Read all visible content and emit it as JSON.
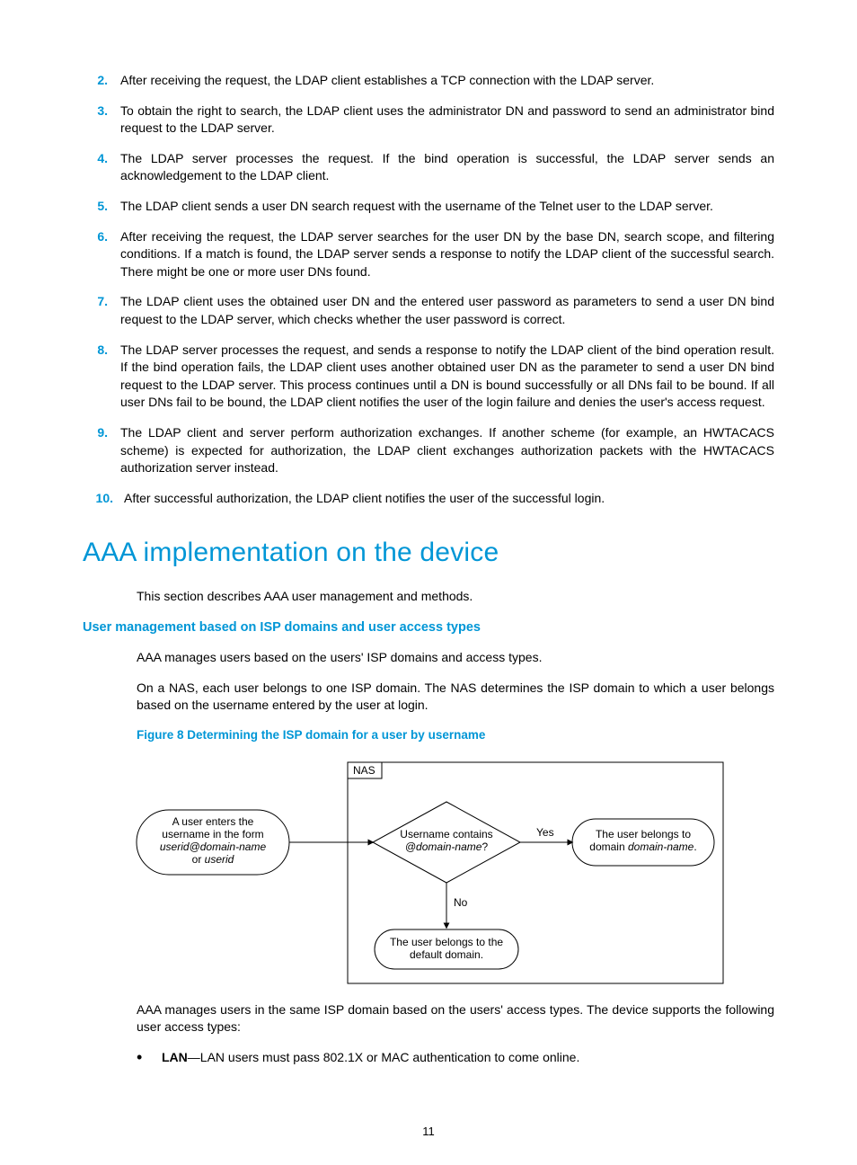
{
  "list": {
    "items": [
      {
        "num": "2.",
        "text": "After receiving the request, the LDAP client establishes a TCP connection with the LDAP server."
      },
      {
        "num": "3.",
        "text": "To obtain the right to search, the LDAP client uses the administrator DN and password to send an administrator bind request to the LDAP server."
      },
      {
        "num": "4.",
        "text": "The LDAP server processes the request. If the bind operation is successful, the LDAP server sends an acknowledgement to the LDAP client."
      },
      {
        "num": "5.",
        "text": "The LDAP client sends a user DN search request with the username of the Telnet user to the LDAP server."
      },
      {
        "num": "6.",
        "text": "After receiving the request, the LDAP server searches for the user DN by the base DN, search scope, and filtering conditions. If a match is found, the LDAP server sends a response to notify the LDAP client of the successful search. There might be one or more user DNs found."
      },
      {
        "num": "7.",
        "text": "The LDAP client uses the obtained user DN and the entered user password as parameters to send a user DN bind request to the LDAP server, which checks whether the user password is correct."
      },
      {
        "num": "8.",
        "text": "The LDAP server processes the request, and sends a response to notify the LDAP client of the bind operation result. If the bind operation fails, the LDAP client uses another obtained user DN as the parameter to send a user DN bind request to the LDAP server. This process continues until a DN is bound successfully or all DNs fail to be bound. If all user DNs fail to be bound, the LDAP client notifies the user of the login failure and denies the user's access request."
      },
      {
        "num": "9.",
        "text": "The LDAP client and server perform authorization exchanges. If another scheme (for example, an HWTACACS scheme) is expected for authorization, the LDAP client exchanges authorization packets with the HWTACACS authorization server instead."
      },
      {
        "num": "10.",
        "text": "After successful authorization, the LDAP client notifies the user of the successful login."
      }
    ]
  },
  "heading": "AAA implementation on the device",
  "intro": "This section describes AAA user management and methods.",
  "subheading": "User management based on ISP domains and user access types",
  "para1": "AAA manages users based on the users' ISP domains and access types.",
  "para2": "On a NAS, each user belongs to one ISP domain. The NAS determines the ISP domain to which a user belongs based on the username entered by the user at login.",
  "figcaption": "Figure 8 Determining the ISP domain for a user by username",
  "diagram": {
    "nas": "NAS",
    "box1_l1": "A user enters the",
    "box1_l2": "username in the form",
    "box1_l3a": "userid@domain-name",
    "box1_l4a": "or ",
    "box1_l4b": "userid",
    "decision_l1": "Username contains",
    "decision_l2a": "@domain-name",
    "decision_l2b": "?",
    "yes": "Yes",
    "no": "No",
    "box2_l1": "The user belongs to",
    "box2_l2a": "domain ",
    "box2_l2b": "domain-name",
    "box2_l2c": ".",
    "box3_l1": "The user belongs to the",
    "box3_l2": "default domain."
  },
  "para3": "AAA manages users in the same ISP domain based on the users' access types. The device supports the following user access types:",
  "bullet1_bold": "LAN",
  "bullet1_rest": "—LAN users must pass 802.1X or MAC authentication to come online.",
  "page_number": "11"
}
